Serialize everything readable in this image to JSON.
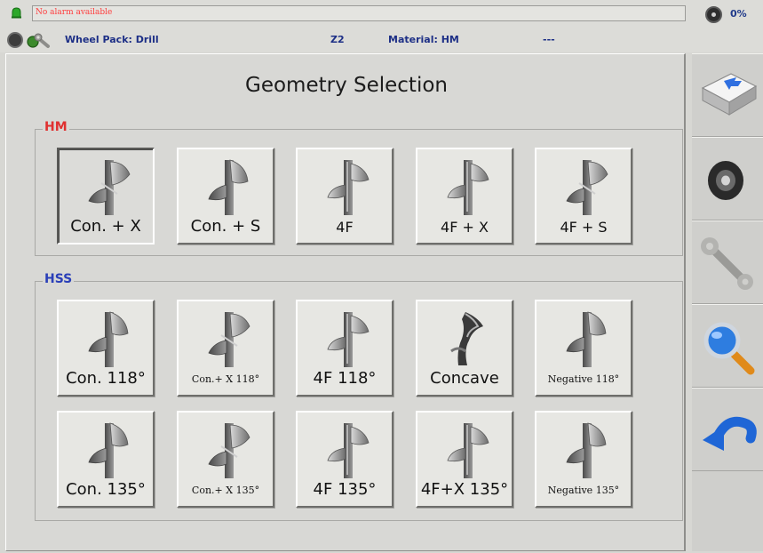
{
  "status": {
    "alarm_text": "No alarm available",
    "progress": "0%"
  },
  "info": {
    "wheel_pack": "Wheel Pack: Drill",
    "zone": "Z2",
    "material": "Material: HM",
    "extra": "---"
  },
  "title": "Geometry Selection",
  "groups": [
    {
      "label": "HM",
      "color": "#e03030",
      "tools": [
        {
          "label": "Con. + X",
          "selected": true
        },
        {
          "label": "Con. + S"
        },
        {
          "label": "4F"
        },
        {
          "label": "4F + X"
        },
        {
          "label": "4F + S"
        }
      ]
    },
    {
      "label": "HSS",
      "color": "#2a3fb8",
      "tools": [
        {
          "label": "Con. 118°"
        },
        {
          "label": "Con.+ X 118°"
        },
        {
          "label": "4F 118°"
        },
        {
          "label": "Concave"
        },
        {
          "label": "Negative 118°"
        },
        {
          "label": "Con. 135°"
        },
        {
          "label": "Con.+ X 135°"
        },
        {
          "label": "4F 135°"
        },
        {
          "label": "4F+X 135°"
        },
        {
          "label": "Negative 135°"
        }
      ]
    }
  ],
  "toolbar": [
    {
      "icon": "keyboard-key-icon"
    },
    {
      "icon": "grinding-wheel-icon"
    },
    {
      "icon": "wrench-icon"
    },
    {
      "icon": "magnifier-icon"
    },
    {
      "icon": "undo-arrow-icon"
    }
  ]
}
